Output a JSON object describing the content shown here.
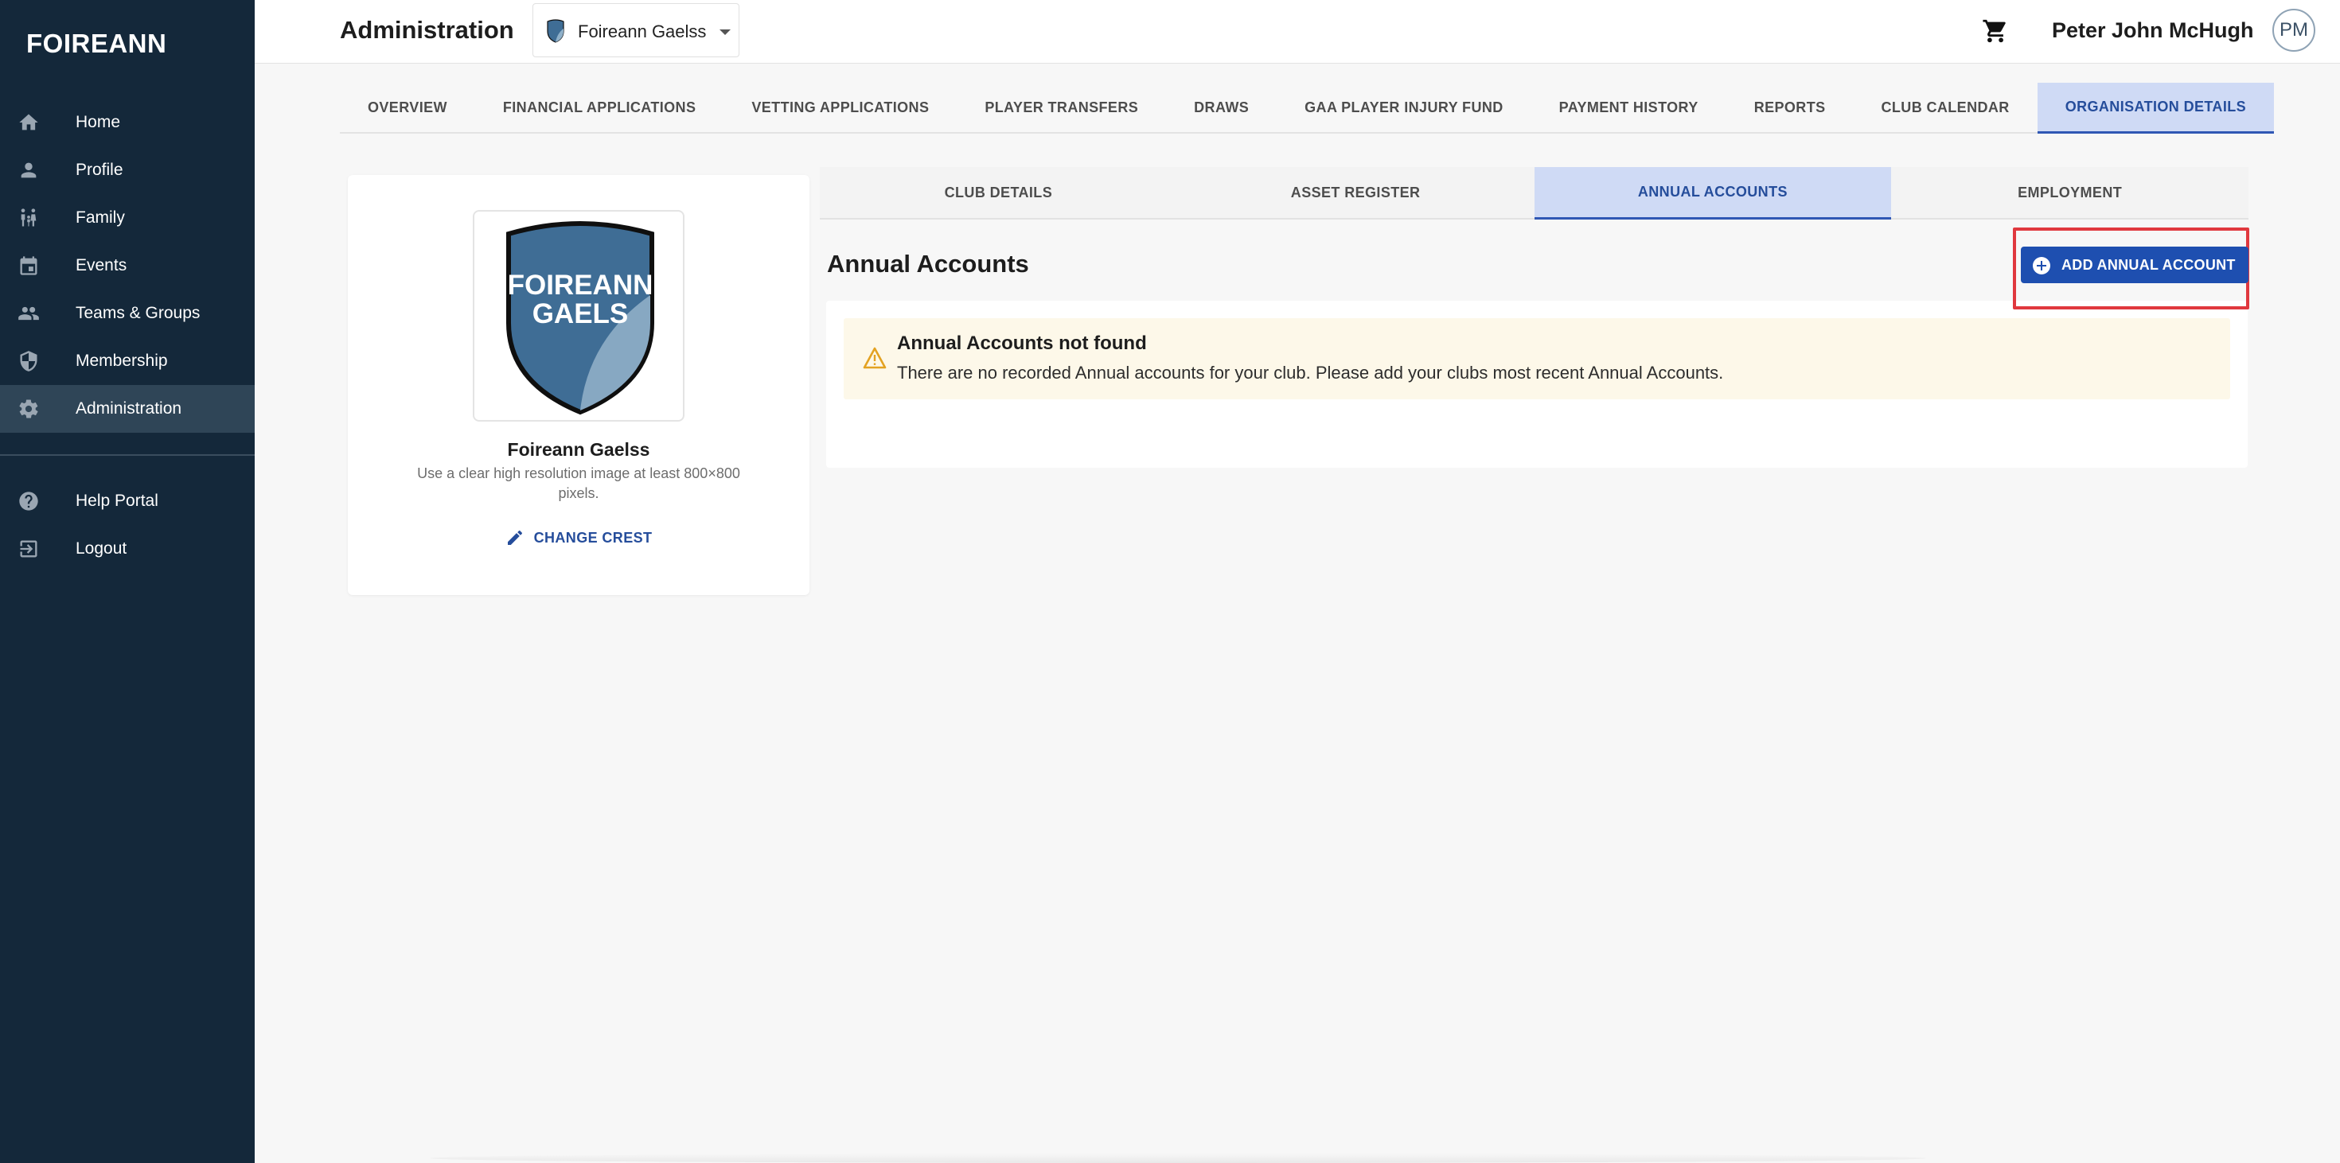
{
  "brand": "FOIREANN",
  "sidebar": {
    "items": [
      {
        "label": "Home",
        "icon": "home-icon"
      },
      {
        "label": "Profile",
        "icon": "person-icon"
      },
      {
        "label": "Family",
        "icon": "family-icon"
      },
      {
        "label": "Events",
        "icon": "calendar-icon"
      },
      {
        "label": "Teams & Groups",
        "icon": "group-icon"
      },
      {
        "label": "Membership",
        "icon": "shield-icon"
      },
      {
        "label": "Administration",
        "icon": "gear-icon",
        "active": true
      }
    ],
    "secondary": [
      {
        "label": "Help Portal",
        "icon": "help-icon"
      },
      {
        "label": "Logout",
        "icon": "logout-icon"
      }
    ]
  },
  "header": {
    "title": "Administration",
    "org_select": {
      "value": "Foireann Gaelss"
    },
    "user_name": "Peter John McHugh",
    "avatar_initials": "PM"
  },
  "top_tabs": [
    {
      "label": "OVERVIEW"
    },
    {
      "label": "FINANCIAL APPLICATIONS"
    },
    {
      "label": "VETTING APPLICATIONS"
    },
    {
      "label": "PLAYER TRANSFERS"
    },
    {
      "label": "DRAWS"
    },
    {
      "label": "GAA PLAYER INJURY FUND"
    },
    {
      "label": "PAYMENT HISTORY"
    },
    {
      "label": "REPORTS"
    },
    {
      "label": "CLUB CALENDAR"
    },
    {
      "label": "ORGANISATION DETAILS",
      "active": true
    }
  ],
  "crest_card": {
    "crest_text_line1": "FOIREANN",
    "crest_text_line2": "GAELS",
    "club_name": "Foireann Gaelss",
    "hint": "Use a clear high resolution image at least 800×800 pixels.",
    "change_label": "CHANGE CREST"
  },
  "sub_tabs": [
    {
      "label": "CLUB DETAILS"
    },
    {
      "label": "ASSET REGISTER"
    },
    {
      "label": "ANNUAL ACCOUNTS",
      "active": true
    },
    {
      "label": "EMPLOYMENT"
    }
  ],
  "main": {
    "section_title": "Annual Accounts",
    "add_button_label": "ADD ANNUAL ACCOUNT",
    "alert": {
      "title": "Annual Accounts not found",
      "text": "There are no recorded Annual accounts for your club. Please add your clubs most recent Annual Accounts."
    }
  },
  "colors": {
    "sidebar_bg": "#14283a",
    "accent": "#1e4fb0",
    "active_tab_bg": "#cfdaf5",
    "highlight_border": "#e0383e",
    "warning_bg": "#fdf8e9",
    "warning_icon": "#e3a222"
  }
}
